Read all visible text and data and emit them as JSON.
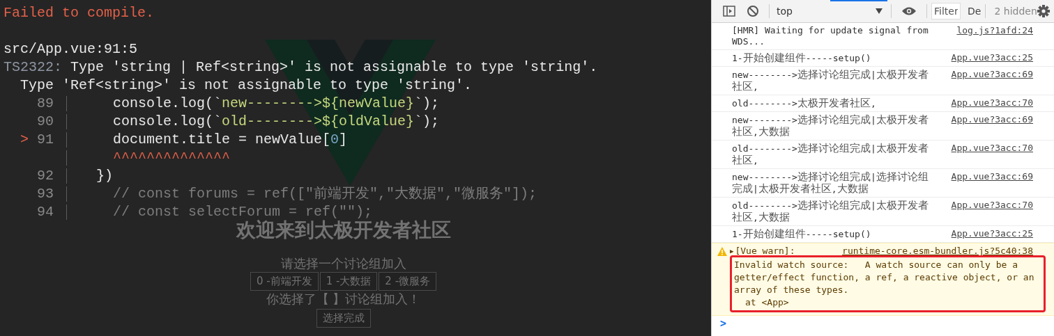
{
  "compile_error": {
    "title": "Failed to compile.",
    "location": "src/App.vue:91:5",
    "code": "TS2322:",
    "message": "Type 'string | Ref<string>' is not assignable to type 'string'.",
    "detail": "Type 'Ref<string>' is not assignable to type 'string'.",
    "lines": [
      {
        "number": "89",
        "segments": [
          {
            "kind": "plain",
            "text": "    console.log(`"
          },
          {
            "kind": "string",
            "text": "new-------->${newValue}"
          },
          {
            "kind": "plain",
            "text": "`);"
          }
        ]
      },
      {
        "number": "90",
        "segments": [
          {
            "kind": "plain",
            "text": "    console.log(`"
          },
          {
            "kind": "string",
            "text": "old-------->${oldValue}"
          },
          {
            "kind": "plain",
            "text": "`);"
          }
        ]
      },
      {
        "number": "91",
        "marker": ">",
        "segments": [
          {
            "kind": "plain",
            "text": "    document.title = newValue["
          },
          {
            "kind": "number",
            "text": "0"
          },
          {
            "kind": "plain",
            "text": "]"
          }
        ]
      },
      {
        "segments": [
          {
            "kind": "error",
            "text": "    ^^^^^^^^^^^^^^"
          }
        ]
      },
      {
        "number": "92",
        "segments": [
          {
            "kind": "plain",
            "text": "  })"
          }
        ]
      },
      {
        "number": "93",
        "segments": [
          {
            "kind": "comment",
            "text": "    // const forums = ref([\"前端开发\",\"大数据\",\"微服务\"]);"
          }
        ]
      },
      {
        "number": "94",
        "segments": [
          {
            "kind": "comment",
            "text": "    // const selectForum = ref(\"\");"
          }
        ]
      }
    ]
  },
  "app_preview": {
    "heading": "欢迎来到太极开发者社区",
    "prompt": "请选择一个讨论组加入",
    "options": [
      {
        "label": "0 -前端开发"
      },
      {
        "label": "1 -大数据"
      },
      {
        "label": "2 -微服务"
      }
    ],
    "selection": "你选择了【 】讨论组加入！",
    "submit": "选择完成"
  },
  "devtools": {
    "toolbar": {
      "context": "top",
      "filter_placeholder": "Filter",
      "levels": "De",
      "hidden_count": "2 hidden"
    },
    "messages": [
      {
        "kind": "log",
        "text": "[HMR] Waiting for update signal from WDS...",
        "source": "log.js?1afd:24"
      },
      {
        "kind": "log",
        "text": "1-开始创建组件-----setup()",
        "source": "App.vue?3acc:25"
      },
      {
        "kind": "log",
        "text": "new-------->选择讨论组完成|太极开发者社区,",
        "source": "App.vue?3acc:69"
      },
      {
        "kind": "log",
        "text": "old-------->太极开发者社区,",
        "source": "App.vue?3acc:70"
      },
      {
        "kind": "log",
        "text": "new-------->选择讨论组完成|太极开发者社区,大数据",
        "source": "App.vue?3acc:69"
      },
      {
        "kind": "log",
        "text": "old-------->选择讨论组完成|太极开发者社区,",
        "source": "App.vue?3acc:70"
      },
      {
        "kind": "log",
        "text": "new-------->选择讨论组完成|选择讨论组完成|太极开发者社区,大数据",
        "source": "App.vue?3acc:69"
      },
      {
        "kind": "log",
        "text": "old-------->选择讨论组完成|太极开发者社区,大数据",
        "source": "App.vue?3acc:70"
      },
      {
        "kind": "log",
        "text": "1-开始创建组件-----setup()",
        "source": "App.vue?3acc:25"
      },
      {
        "kind": "warning",
        "toggle": "▶",
        "text": "[Vue warn]:",
        "source": "runtime-core.esm-bundler.js?5c40:38",
        "detail": "Invalid watch source:   A watch source can only be a getter/effect function, a ref, a reactive object, or an array of these types.",
        "trace": "at <App>",
        "highlighted": true
      }
    ],
    "prompt": ">"
  }
}
